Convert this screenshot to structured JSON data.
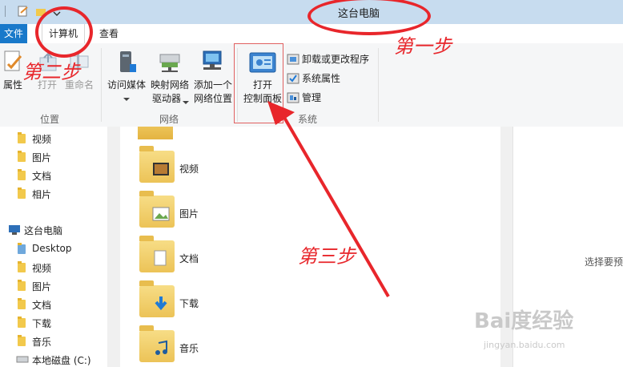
{
  "window": {
    "title": "这台电脑"
  },
  "ribbon": {
    "tabs": {
      "file": "文件",
      "computer": "计算机",
      "view": "查看"
    },
    "location": {
      "label": "位置",
      "properties": "属性",
      "open": "打开",
      "rename": "重命名"
    },
    "network": {
      "label": "网络",
      "access_media_line1": "访问媒体",
      "map_drive_line1": "映射网络",
      "map_drive_line2": "驱动器",
      "add_location_line1": "添加一个",
      "add_location_line2": "网络位置"
    },
    "system": {
      "label": "系统",
      "open_cp_line1": "打开",
      "open_cp_line2": "控制面板",
      "uninstall": "卸载或更改程序",
      "sys_properties": "系统属性",
      "manage": "管理"
    }
  },
  "nav": {
    "top_items": [
      "视频",
      "图片",
      "文档",
      "相片"
    ],
    "this_pc": "这台电脑",
    "pc_items": [
      "Desktop",
      "视频",
      "图片",
      "文档",
      "下载",
      "音乐"
    ],
    "local_disk": "本地磁盘 (C:)"
  },
  "content": {
    "folders": [
      "视频",
      "图片",
      "文档",
      "下载",
      "音乐"
    ]
  },
  "details": {
    "hint": "选择要预"
  },
  "annotations": {
    "step1": "第一步",
    "step2": "第二步",
    "step3": "第三步",
    "color": "#e8262b"
  },
  "watermark": {
    "main": "Bai度经验",
    "sub": "jingyan.baidu.com"
  }
}
